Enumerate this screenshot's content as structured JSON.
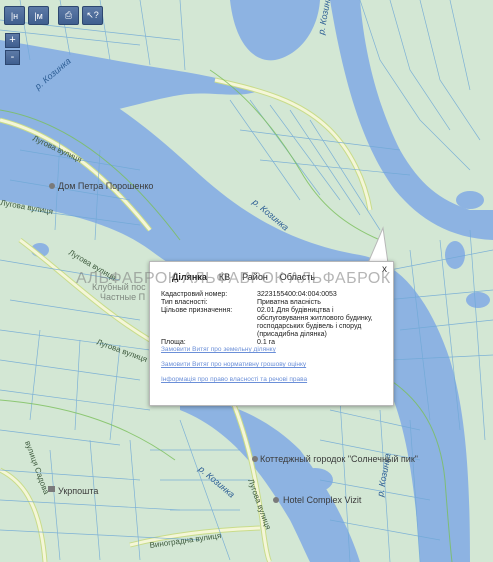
{
  "toolbar": {
    "buttons": [
      {
        "label": "|н",
        "icon": "ruler-icon"
      },
      {
        "label": "|м",
        "icon": "area-measure-icon"
      },
      {
        "label": "⎙",
        "icon": "print-icon"
      },
      {
        "label": "↖?",
        "icon": "info-cursor-icon"
      }
    ]
  },
  "zoom": {
    "in": "+",
    "out": "-"
  },
  "map_labels": {
    "river_top": "р. Козинка",
    "river_mid": "р. Козинка",
    "river_bottom_left": "р. Козинка",
    "river_bottom_right": "р. Козинка",
    "road_lugova_1": "Лугова вулиця",
    "road_lugova_2": "Лугова вулиця",
    "road_lugova_3": "Лугова вулиця",
    "road_lugova_4": "Лугова вулиця",
    "road_lugova_5": "Лугова вулиця",
    "road_sadova": "вулиця Садова",
    "road_vynohradna": "Виноградна вулиця",
    "poi_poroshenko": "Дом Петра Порошенко",
    "poi_sonyachnyi": "Коттеджный городок \"Солнечный пик\"",
    "poi_hotel": "Hotel Complex Vizit",
    "poi_ukrposhta": "Укрпошта",
    "poi_chastnye": "Частные П",
    "poi_klubnyi": "Клубный пос"
  },
  "popup": {
    "tabs": [
      "Ділянка",
      "КВ",
      "Район",
      "Область"
    ],
    "active_tab": 0,
    "close": "x",
    "fields": [
      {
        "key": "Кадастровий номер:",
        "value": "3223155400:04:004:0053"
      },
      {
        "key": "Тип власності:",
        "value": "Приватна власність"
      },
      {
        "key": "Цільове призначення:",
        "value": "02.01 Для будівництва і обслуговування житлового будинку, господарських будівель і споруд (присадибна ділянка)"
      },
      {
        "key": "Площа:",
        "value": "0.1 га"
      }
    ],
    "links": [
      "Замовити Витяг про земельну ділянку",
      "Замовити Витяг про нормативну грошову оцінку",
      "Інформація про право власності та речові права"
    ]
  },
  "watermark": "АЛЬФАБРОК АЛЬФАБРОК АЛЬФАБРОК",
  "colors": {
    "land": "#cfe6cf",
    "water": "#8fb3e0",
    "parcel_line": "#6fa8d6",
    "road": "#f4f6d8",
    "road_edge": "#c9dc8a"
  }
}
